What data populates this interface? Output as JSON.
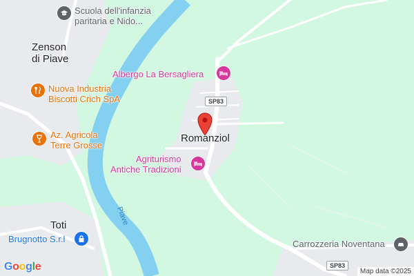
{
  "map": {
    "attribution": "Map data ©2025",
    "logo_letters": [
      "G",
      "o",
      "o",
      "g",
      "l",
      "e"
    ],
    "logo_colors": [
      "#4285f4",
      "#ea4335",
      "#fbbc05",
      "#4285f4",
      "#34a853",
      "#ea4335"
    ],
    "colors": {
      "land": "#d3f8e2",
      "urban": "#e8eaed",
      "river": "#83d0f0",
      "road": "#ffffff",
      "pin": "#ea4335",
      "orange_poi": "#e8710a",
      "pink_poi": "#d6399a",
      "grey_poi": "#5f6368",
      "blue_poi": "#1a73e8"
    }
  },
  "places": {
    "school": {
      "line1": "Scuola dell'infanzia",
      "line2": "paritaria e Nido...",
      "icon": "graduation-cap-icon"
    },
    "zenson": {
      "line1": "Zenson",
      "line2": "di Piave"
    },
    "biscotti": {
      "line1": "Nuova Industria",
      "line2": "Biscotti Crich SpA",
      "icon": "fork-knife-icon"
    },
    "agricola": {
      "line1": "Az. Agricola",
      "line2": "Terre Grosse",
      "icon": "wine-glass-icon"
    },
    "albergo": {
      "name": "Albergo La Bersagliera",
      "icon": "bed-icon"
    },
    "romanziol": {
      "name": "Romanziol",
      "icon": "red-pin-icon"
    },
    "agriturismo": {
      "line1": "Agriturismo",
      "line2": "Antiche Tradizioni",
      "icon": "bed-icon"
    },
    "toti": {
      "name": "Toti"
    },
    "brugnotto": {
      "name": "Brugnotto S.r.l",
      "icon": "lock-icon"
    },
    "carrozzeria": {
      "name": "Carrozzeria Noventana",
      "icon": "car-icon"
    }
  },
  "roads": {
    "sp83_north": "SP83",
    "sp83_south": "SP83"
  },
  "river": {
    "name": "Piave"
  }
}
